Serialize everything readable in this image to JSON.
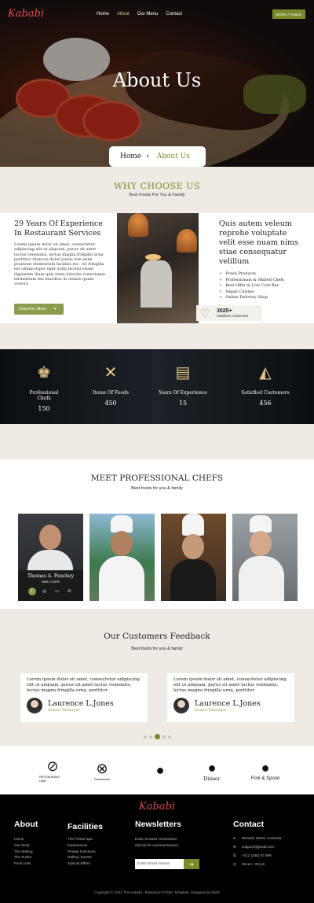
{
  "brand": {
    "logo": "Kababi"
  },
  "nav": {
    "items": [
      {
        "label": "Home"
      },
      {
        "label": "About"
      },
      {
        "label": "Our Menu"
      },
      {
        "label": "Contact"
      }
    ],
    "cta": "BOOK A TABLE"
  },
  "hero": {
    "title": "About Us",
    "breadcrumb": {
      "home": "Home",
      "current": "About Us"
    }
  },
  "why": {
    "title": "WHY CHOOSE US",
    "subtitle": "Best Foods For You & Family"
  },
  "about": {
    "left_title": "29 Years Of Experience In Restaurant Services",
    "left_text": "Lorem ipsum dolor sit amet, consectetur adipiscing elit ut aliquam, purus sit amet luctus venenatis, lectus magna fringilla urna, porttitor rhoncus dolor purus non enim praesent elementum facilisis leo, vel fringilla est ullamcorper eget nulla facilisi etiam dignissim diam quis enim lobortis scelerisque fermentum dui faucibus in ornare quam viverra",
    "button": "Discover More",
    "right_title": "Quis autem veleum reprehe voluptate velit esse nuam nims stiae consequatur velillum",
    "features": [
      "Fresh Products",
      "Professionals & Skilled Chefs",
      "Best Offer & Low Cost Bar",
      "Vegan Cuisine",
      "Online Delivery Shop"
    ],
    "badge": {
      "value": "3025+",
      "label": "Satisfied Customers"
    }
  },
  "stats": [
    {
      "icon": "chef-hat-icon",
      "label": "Professional Chefs",
      "value": "150"
    },
    {
      "icon": "cutlery-icon",
      "label": "Items Of Foods",
      "value": "450"
    },
    {
      "icon": "grill-icon",
      "label": "Years Of Experience",
      "value": "15"
    },
    {
      "icon": "pizza-icon",
      "label": "Saticfied Customers",
      "value": "456"
    }
  ],
  "chefs": {
    "title": "MEET PROFESSIONAL CHEFS",
    "subtitle": "Best foods for you & family",
    "featured": {
      "name": "Thomas A. Peachey",
      "role": "Main Chefs"
    }
  },
  "feedback": {
    "title": "Our Customers Feedback",
    "subtitle": "Best foods for you & family",
    "items": [
      {
        "text": "Lorem ipsum dolor sit amet, consectetur adipiscing elit ut aliquam, purus sit amet luctus venenatis, lectus magna fringilla urna, porttitor",
        "name": "Laurence L.Jones",
        "role": "Senior Manager"
      },
      {
        "text": "Lorem ipsum dolor sit amet, consectetur adipiscing elit ut aliquam, purus sit amet luctus venenatis, lectus magna fringilla urna, porttitor",
        "name": "Laurence L.Jones",
        "role": "Senior Manager"
      }
    ]
  },
  "partners": [
    {
      "label": "RESTAURANT LINE"
    },
    {
      "label": "Restaurant"
    },
    {
      "label": ""
    },
    {
      "label": "Dinner"
    },
    {
      "label": "Fork & Spoon"
    }
  ],
  "footer": {
    "logo": "Kababi",
    "about": {
      "title": "About",
      "links": [
        "Home",
        "Our Story",
        "The Setting",
        "The Suites",
        "Food Lists"
      ]
    },
    "facilities": {
      "title": "Facilities",
      "links": [
        "The Fortus Spa",
        "Experiences",
        "Private Functions",
        "Gallery, Events",
        "Special Offers"
      ]
    },
    "newsletter": {
      "title": "Newsletters",
      "text1": "Dolor sit amet consectetur",
      "text2": "elit sed do eiusmod tempor.",
      "placeholder": "Enter Email Adress"
    },
    "contact": {
      "title": "Contact",
      "address": "56 Main Street, Australia",
      "email": "support@gmail.com",
      "phone": "+012 (345) 67 899",
      "hours": "08 am - 06 pm"
    },
    "copyright": "Copyright © 2021 The Kababi - Restaurant HTML Template. Designed by BMS"
  },
  "colors": {
    "accent": "#7a8a2a",
    "logo": "#e14b5a",
    "bg": "#efebe4"
  }
}
